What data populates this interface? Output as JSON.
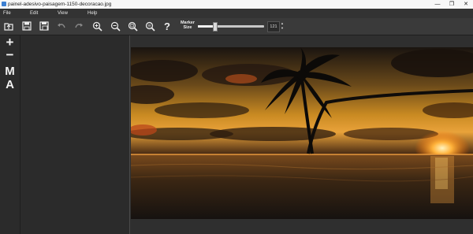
{
  "window": {
    "title": "painel-adesivo-paisagem-1150-decoracao.jpg",
    "controls": {
      "minimize": "—",
      "maximize": "❐",
      "close": "✕"
    }
  },
  "menu": {
    "file": "File",
    "edit": "Edit",
    "view": "View",
    "help": "Help"
  },
  "toolbar": {
    "buttons": [
      "open-icon",
      "save-icon",
      "save-as-icon",
      "undo-icon",
      "redo-icon",
      "zoom-in-icon",
      "zoom-out-icon",
      "zoom-fit-icon",
      "zoom-actual-icon",
      "help-icon"
    ],
    "help_glyph": "?",
    "marker_label_line1": "Marker",
    "marker_label_line2": "Size",
    "marker_size_value": "121",
    "marker_size_fraction": 0.25,
    "spin_up": "▲",
    "spin_down": "▼"
  },
  "left_tools": {
    "add": "+",
    "remove": "−",
    "m": "M",
    "a": "A"
  },
  "colors": {
    "accent": "#3c7fd1",
    "background": "#2b2b2b"
  }
}
